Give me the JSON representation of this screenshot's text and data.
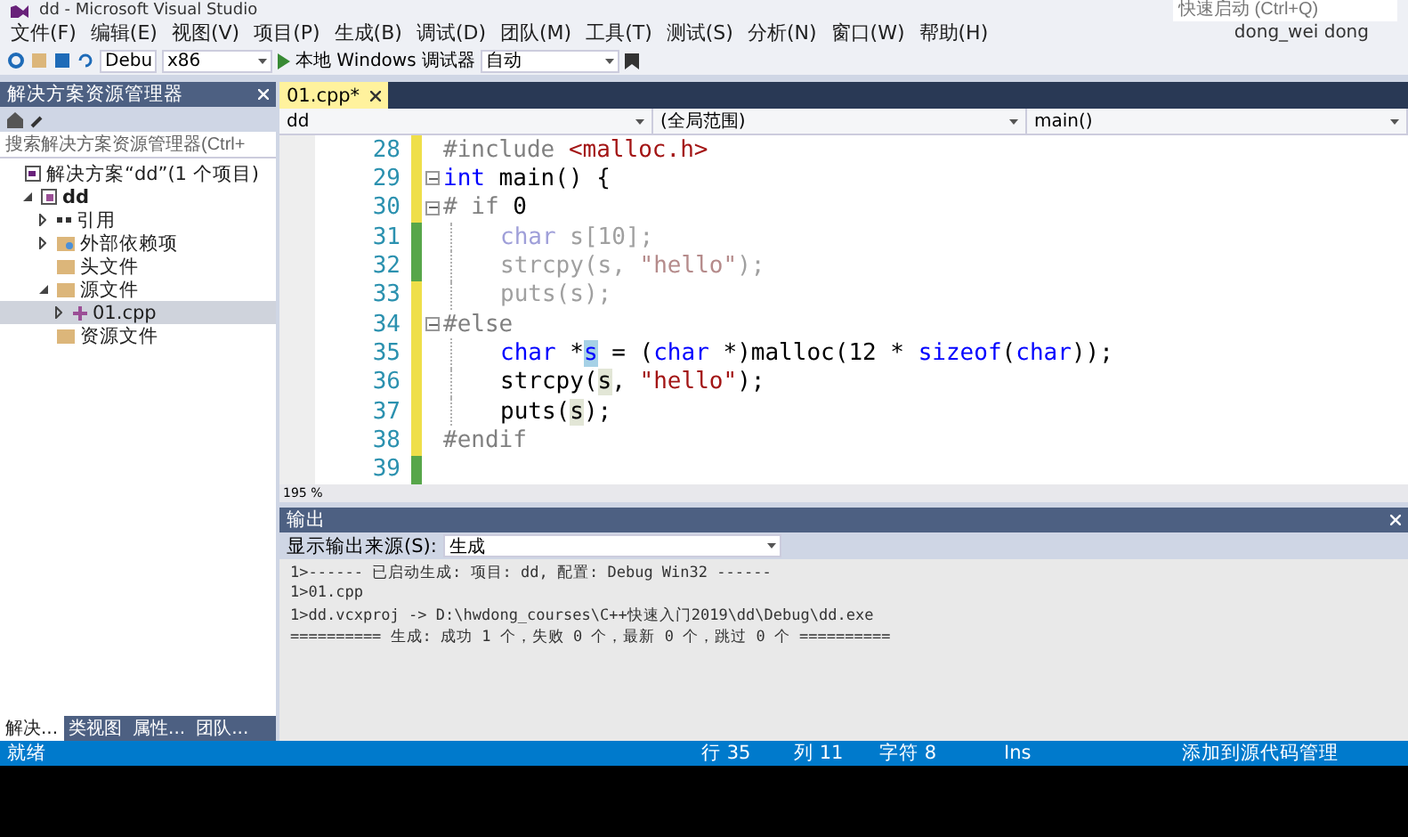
{
  "window": {
    "title": "dd - Microsoft Visual Studio",
    "quick_launch": {
      "placeholder": "快速启动 (Ctrl+Q)"
    },
    "user": "dong_wei dong"
  },
  "menu": [
    "文件(F)",
    "编辑(E)",
    "视图(V)",
    "项目(P)",
    "生成(B)",
    "调试(D)",
    "团队(M)",
    "工具(T)",
    "测试(S)",
    "分析(N)",
    "窗口(W)",
    "帮助(H)"
  ],
  "toolbar": {
    "config": "Debu",
    "platform": "x86",
    "run": "本地 Windows 调试器",
    "mode": "自动"
  },
  "solution_explorer": {
    "title": "解决方案资源管理器",
    "search": {
      "placeholder": "搜索解决方案资源管理器(Ctrl+"
    },
    "tree": [
      {
        "label": "解决方案“dd”(1 个项目)",
        "kind": "solution",
        "selected": false,
        "children": [
          {
            "label": "dd",
            "kind": "project",
            "expanded": true,
            "selected": false,
            "children": [
              {
                "label": "引用",
                "kind": "references",
                "expanded": false,
                "selected": false
              },
              {
                "label": "外部依赖项",
                "kind": "external",
                "expanded": false,
                "selected": false
              },
              {
                "label": "头文件",
                "kind": "folder",
                "selected": false
              },
              {
                "label": "源文件",
                "kind": "folder",
                "expanded": true,
                "selected": false,
                "children": [
                  {
                    "label": "01.cpp",
                    "kind": "file",
                    "expanded": false,
                    "selected": true
                  }
                ]
              },
              {
                "label": "资源文件",
                "kind": "folder",
                "selected": false
              }
            ]
          }
        ]
      }
    ],
    "tabs": [
      {
        "label": "解决...",
        "selected": true
      },
      {
        "label": "类视图",
        "selected": false
      },
      {
        "label": "属性...",
        "selected": false
      },
      {
        "label": "团队...",
        "selected": false
      }
    ]
  },
  "editor": {
    "tab": "01.cpp*",
    "nav": [
      "dd",
      "(全局范围)",
      "main()"
    ],
    "zoom": "195 %",
    "lines": [
      {
        "number": "28",
        "color": "#efdf4a",
        "fold": false,
        "indented": false,
        "tokens": [
          {
            "t": "#include ",
            "kind": "pre"
          },
          {
            "t": "<malloc.h>",
            "kind": "str"
          }
        ]
      },
      {
        "number": "29",
        "color": "#efdf4a",
        "fold": true,
        "indented": false,
        "tokens": [
          {
            "t": "int",
            "kind": "kw"
          },
          {
            "t": " main() {",
            "kind": "plain"
          }
        ]
      },
      {
        "number": "30",
        "color": "#efdf4a",
        "fold": true,
        "indented": false,
        "tokens": [
          {
            "t": "# if ",
            "kind": "pre"
          },
          {
            "t": "0",
            "kind": "plain"
          }
        ]
      },
      {
        "number": "31",
        "color": "#57a64a",
        "fold": false,
        "indented": true,
        "tokens": [
          {
            "t": "char",
            "kind": "inactive_kw"
          },
          {
            "t": " s[10];",
            "kind": "inactive"
          }
        ]
      },
      {
        "number": "32",
        "color": "#57a64a",
        "fold": false,
        "indented": true,
        "tokens": [
          {
            "t": "strcpy(s, ",
            "kind": "inactive"
          },
          {
            "t": "\"hello\"",
            "kind": "inactive_str"
          },
          {
            "t": ");",
            "kind": "inactive"
          }
        ]
      },
      {
        "number": "33",
        "color": "#efdf4a",
        "fold": false,
        "indented": true,
        "tokens": [
          {
            "t": "puts(s);",
            "kind": "inactive"
          }
        ]
      },
      {
        "number": "34",
        "color": "#efdf4a",
        "fold": true,
        "indented": false,
        "tokens": [
          {
            "t": "#else",
            "kind": "pre"
          }
        ]
      },
      {
        "number": "35",
        "color": "#efdf4a",
        "fold": false,
        "indented": true,
        "tokens": [
          {
            "t": "char",
            "kind": "kw"
          },
          {
            "t": " *",
            "kind": "plain"
          },
          {
            "t": "s",
            "kind": "selected"
          },
          {
            "t": " = (",
            "kind": "plain"
          },
          {
            "t": "char",
            "kind": "kw"
          },
          {
            "t": " *)malloc(12 * ",
            "kind": "plain"
          },
          {
            "t": "sizeof",
            "kind": "kw"
          },
          {
            "t": "(",
            "kind": "plain"
          },
          {
            "t": "char",
            "kind": "kw"
          },
          {
            "t": "));",
            "kind": "plain"
          }
        ]
      },
      {
        "number": "36",
        "color": "#efdf4a",
        "fold": false,
        "indented": true,
        "tokens": [
          {
            "t": "strcpy(",
            "kind": "plain"
          },
          {
            "t": "s",
            "kind": "ref"
          },
          {
            "t": ", ",
            "kind": "plain"
          },
          {
            "t": "\"hello\"",
            "kind": "str"
          },
          {
            "t": ");",
            "kind": "plain"
          }
        ]
      },
      {
        "number": "37",
        "color": "#efdf4a",
        "fold": false,
        "indented": true,
        "tokens": [
          {
            "t": "puts(",
            "kind": "plain"
          },
          {
            "t": "s",
            "kind": "ref"
          },
          {
            "t": ");",
            "kind": "plain"
          }
        ]
      },
      {
        "number": "38",
        "color": "#efdf4a",
        "fold": false,
        "indented": false,
        "tokens": [
          {
            "t": "#endif",
            "kind": "pre"
          }
        ]
      },
      {
        "number": "39",
        "color": "#57a64a",
        "fold": false
      }
    ]
  },
  "output": {
    "title": "输出",
    "source_label": "显示输出来源(S):",
    "source": "生成",
    "lines": [
      "1>------ 已启动生成: 项目: dd, 配置: Debug Win32 ------",
      "1>01.cpp",
      "1>dd.vcxproj -> D:\\hwdong_courses\\C++快速入门2019\\dd\\Debug\\dd.exe",
      "========== 生成: 成功 1 个，失败 0 个，最新 0 个，跳过 0 个 =========="
    ]
  },
  "status_bar": {
    "state": "就绪",
    "line": "行 35",
    "column": "列 11",
    "char": "字符 8",
    "mode": "Ins",
    "source_control": "添加到源代码管理"
  }
}
